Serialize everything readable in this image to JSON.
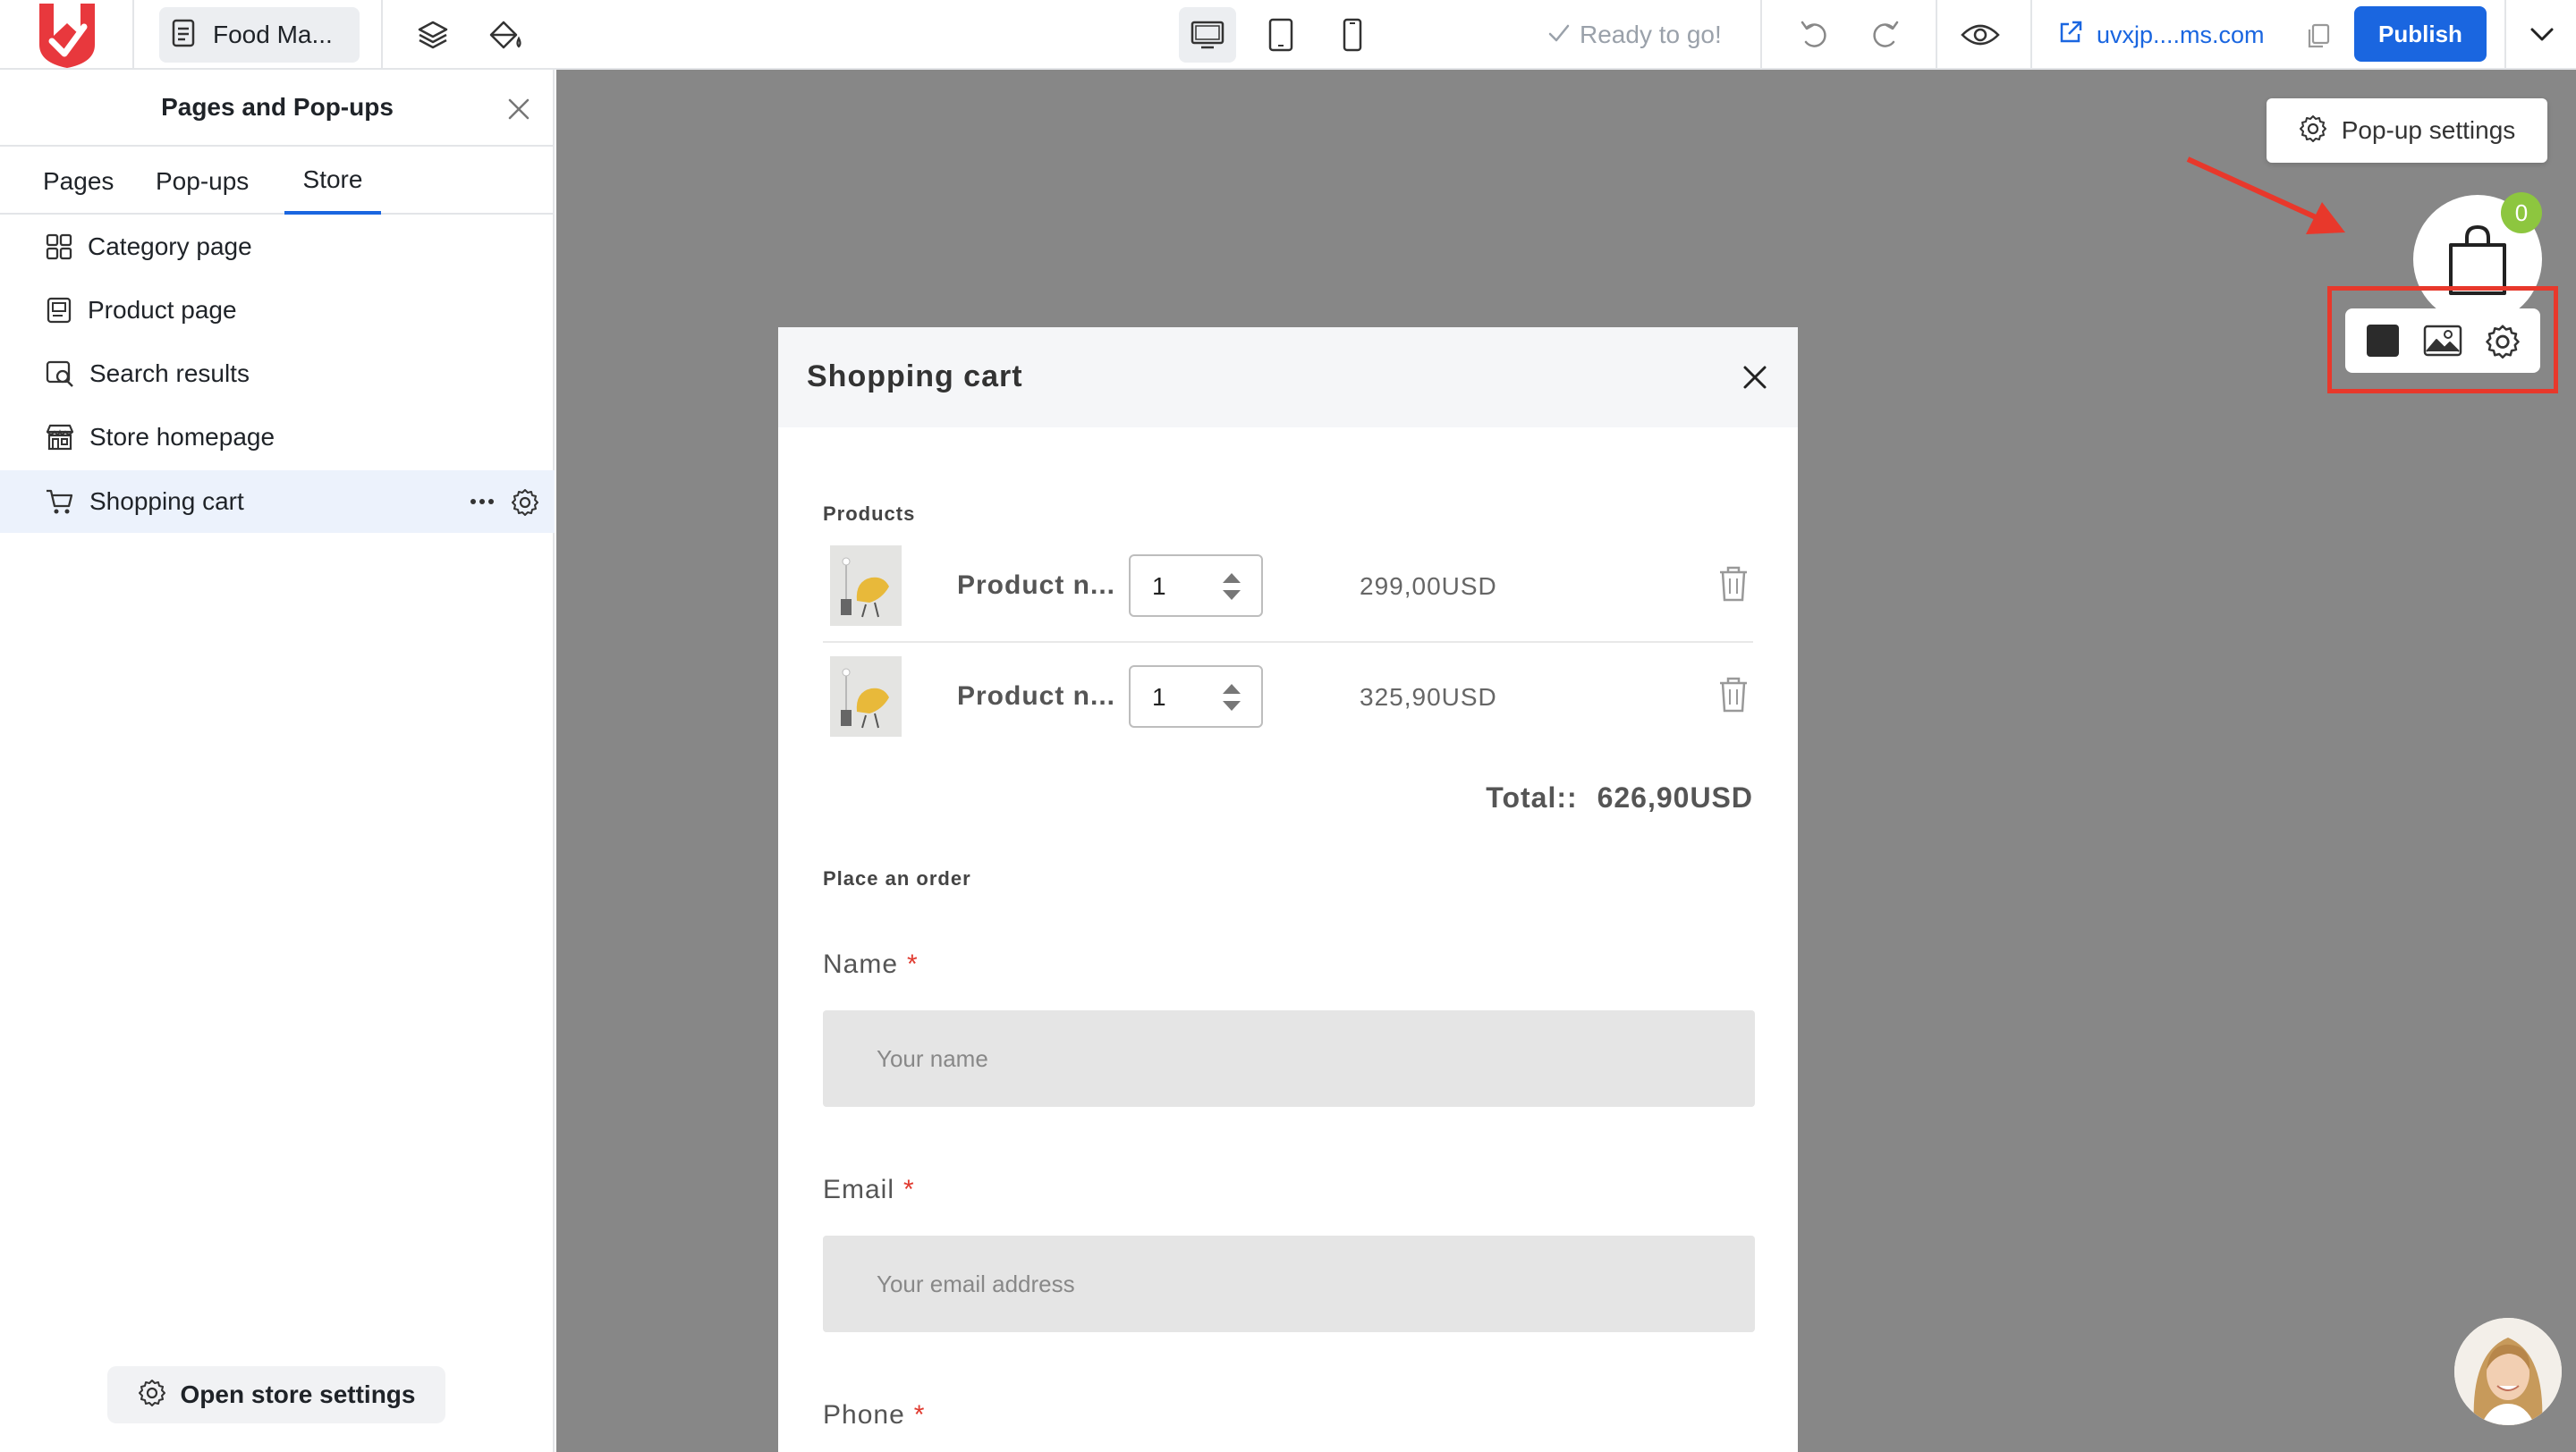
{
  "topbar": {
    "page_name": "Food Ma...",
    "status": "Ready to go!",
    "site_link": "uvxjp....ms.com",
    "publish_label": "Publish"
  },
  "sidebar": {
    "title": "Pages and Pop-ups",
    "tabs": [
      {
        "label": "Pages"
      },
      {
        "label": "Pop-ups"
      },
      {
        "label": "Store"
      }
    ],
    "active_tab": "Store",
    "items": [
      {
        "label": "Category page",
        "icon": "grid-icon"
      },
      {
        "label": "Product page",
        "icon": "product-page-icon"
      },
      {
        "label": "Search results",
        "icon": "search-results-icon"
      },
      {
        "label": "Store homepage",
        "icon": "storefront-icon"
      },
      {
        "label": "Shopping cart",
        "icon": "cart-icon"
      }
    ],
    "selected_item": "Shopping cart",
    "open_store_label": "Open store settings"
  },
  "canvas": {
    "popup_settings_label": "Pop-up settings",
    "cart_badge": "0"
  },
  "modal": {
    "title": "Shopping cart",
    "products_label": "Products",
    "products": [
      {
        "name": "Product n...",
        "qty": "1",
        "price": "299,00USD"
      },
      {
        "name": "Product n...",
        "qty": "1",
        "price": "325,90USD"
      }
    ],
    "total_label": "Total::",
    "total_value": "626,90USD",
    "order_label": "Place an order",
    "fields": [
      {
        "label": "Name",
        "required": "*",
        "placeholder": "Your name"
      },
      {
        "label": "Email",
        "required": "*",
        "placeholder": "Your email address"
      },
      {
        "label": "Phone",
        "required": "*"
      }
    ]
  },
  "colors": {
    "accent": "#1a66e0",
    "canvas_bg": "#878787",
    "highlight_red": "#e8382b",
    "badge_green": "#8dc63f"
  }
}
